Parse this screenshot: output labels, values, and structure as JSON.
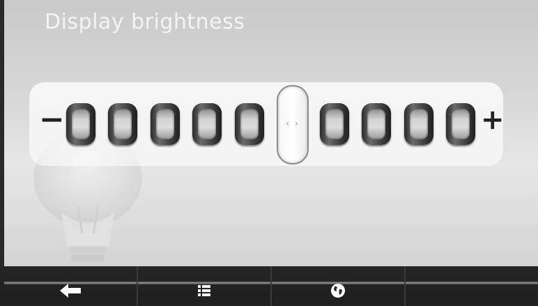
{
  "header": {
    "title": "Display brightness"
  },
  "brightness": {
    "minus_label": "−",
    "plus_label": "+",
    "level_steps_before_handle": 5,
    "level_steps_after_handle": 4,
    "level_fraction": 0.5,
    "handle_glyph": "‹ ›"
  },
  "navbar": {
    "buttons": [
      {
        "icon": "back-arrow-icon"
      },
      {
        "icon": "list-icon"
      },
      {
        "icon": "globe-icon"
      },
      {
        "icon": ""
      }
    ]
  },
  "colors": {
    "background": "#d6d6d6",
    "navbar": "#1e1e1e",
    "title": "#f4f4f4"
  }
}
